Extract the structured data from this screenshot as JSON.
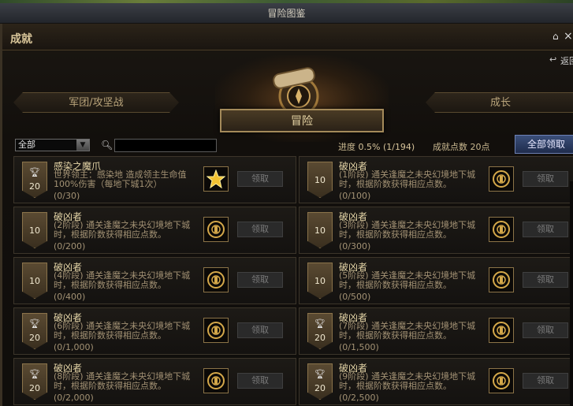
{
  "window": {
    "title": "冒险图鉴"
  },
  "header": {
    "section_label": "成就",
    "return_label": "返回"
  },
  "tabs": {
    "left": "军团/攻坚战",
    "center": "冒险",
    "right": "成长"
  },
  "toolbar": {
    "filter_value": "全部",
    "search_value": "",
    "progress_label": "进度",
    "progress_value": "0.5% (1/194)",
    "points_label": "成就点数 20点",
    "claim_all_label": "全部领取"
  },
  "cards": [
    {
      "title": "感染之魔爪",
      "desc": "世界领主：感染地      造成领主生命值100%伤害（每地下城1次）",
      "count": "(0/30)",
      "points": "20",
      "trophy": true,
      "icon": "star-icon",
      "claim": "领取"
    },
    {
      "title": "破凶者",
      "desc": "(1阶段) 通关逢魔之未央幻境地下城时，根据阶数获得相应点数。",
      "count": "(0/100)",
      "points": "10",
      "trophy": false,
      "icon": "seal-icon",
      "claim": "领取"
    },
    {
      "title": "破凶者",
      "desc": "(2阶段) 通关逢魔之未央幻境地下城时，根据阶数获得相应点数。",
      "count": "(0/200)",
      "points": "10",
      "trophy": false,
      "icon": "seal-icon",
      "claim": "领取"
    },
    {
      "title": "破凶者",
      "desc": "(3阶段) 通关逢魔之未央幻境地下城时，根据阶数获得相应点数。",
      "count": "(0/300)",
      "points": "10",
      "trophy": false,
      "icon": "seal-icon",
      "claim": "领取"
    },
    {
      "title": "破凶者",
      "desc": "(4阶段) 通关逢魔之未央幻境地下城时，根据阶数获得相应点数。",
      "count": "(0/400)",
      "points": "10",
      "trophy": false,
      "icon": "seal-icon",
      "claim": "领取"
    },
    {
      "title": "破凶者",
      "desc": "(5阶段) 通关逢魔之未央幻境地下城时，根据阶数获得相应点数。",
      "count": "(0/500)",
      "points": "10",
      "trophy": false,
      "icon": "seal-icon",
      "claim": "领取"
    },
    {
      "title": "破凶者",
      "desc": "(6阶段) 通关逢魔之未央幻境地下城时，根据阶数获得相应点数。",
      "count": "(0/1,000)",
      "points": "20",
      "trophy": true,
      "icon": "seal-icon",
      "claim": "领取"
    },
    {
      "title": "破凶者",
      "desc": "(7阶段) 通关逢魔之未央幻境地下城时，根据阶数获得相应点数。",
      "count": "(0/1,500)",
      "points": "20",
      "trophy": true,
      "icon": "seal-icon",
      "claim": "领取"
    },
    {
      "title": "破凶者",
      "desc": "(8阶段) 通关逢魔之未央幻境地下城时，根据阶数获得相应点数。",
      "count": "(0/2,000)",
      "points": "20",
      "trophy": true,
      "icon": "seal-icon",
      "claim": "领取"
    },
    {
      "title": "破凶者",
      "desc": "(9阶段) 通关逢魔之未央幻境地下城时，根据阶数获得相应点数。",
      "count": "(0/2,500)",
      "points": "20",
      "trophy": true,
      "icon": "seal-icon",
      "claim": "领取"
    }
  ]
}
